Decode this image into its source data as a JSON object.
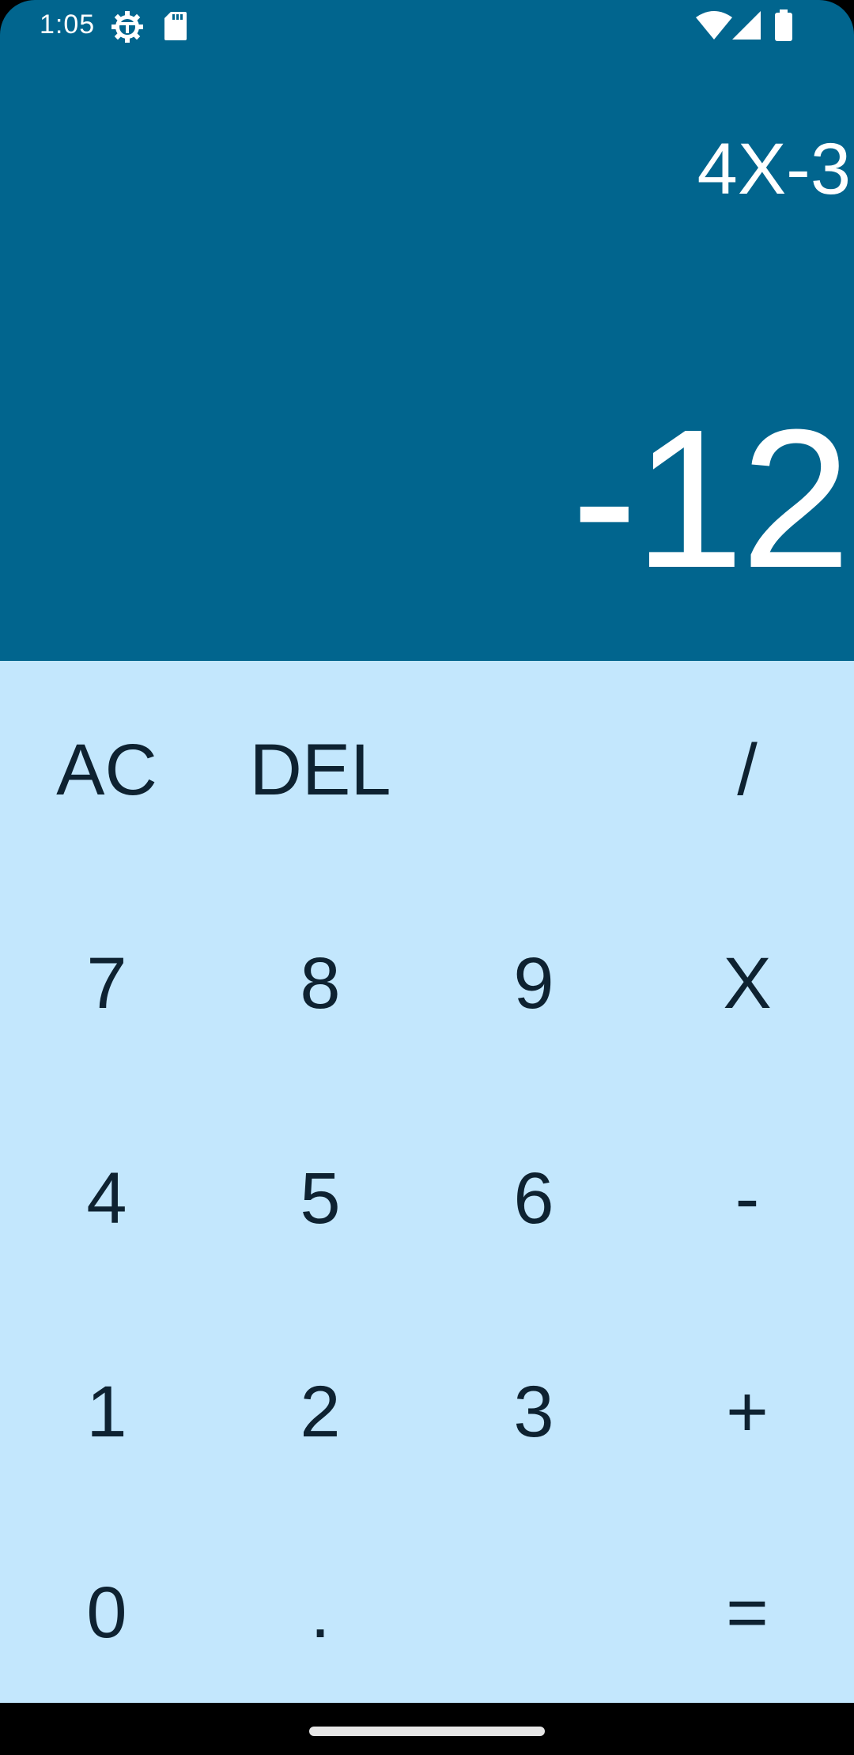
{
  "status_bar": {
    "time": "1:05",
    "icons": [
      "settings-gear-icon",
      "sd-card-icon",
      "wifi-icon",
      "cell-signal-icon",
      "battery-icon"
    ]
  },
  "display": {
    "expression": "4X-3",
    "result": "-12"
  },
  "keypad": {
    "rows": [
      [
        {
          "label": "AC",
          "name": "all-clear-button"
        },
        {
          "label": "DEL",
          "name": "delete-button"
        },
        {
          "label": "",
          "name": "empty-slot"
        },
        {
          "label": "/",
          "name": "divide-button"
        }
      ],
      [
        {
          "label": "7",
          "name": "digit-7-button"
        },
        {
          "label": "8",
          "name": "digit-8-button"
        },
        {
          "label": "9",
          "name": "digit-9-button"
        },
        {
          "label": "X",
          "name": "multiply-button"
        }
      ],
      [
        {
          "label": "4",
          "name": "digit-4-button"
        },
        {
          "label": "5",
          "name": "digit-5-button"
        },
        {
          "label": "6",
          "name": "digit-6-button"
        },
        {
          "label": "-",
          "name": "subtract-button"
        }
      ],
      [
        {
          "label": "1",
          "name": "digit-1-button"
        },
        {
          "label": "2",
          "name": "digit-2-button"
        },
        {
          "label": "3",
          "name": "digit-3-button"
        },
        {
          "label": "+",
          "name": "add-button"
        }
      ],
      [
        {
          "label": "0",
          "name": "digit-0-button"
        },
        {
          "label": ".",
          "name": "decimal-point-button"
        },
        {
          "label": "",
          "name": "empty-slot"
        },
        {
          "label": "=",
          "name": "equals-button"
        }
      ]
    ]
  },
  "colors": {
    "display_bg": "#01658E",
    "keypad_bg": "#C3E7FD",
    "key_text": "#0E2231",
    "display_text": "#FFFFFF"
  }
}
